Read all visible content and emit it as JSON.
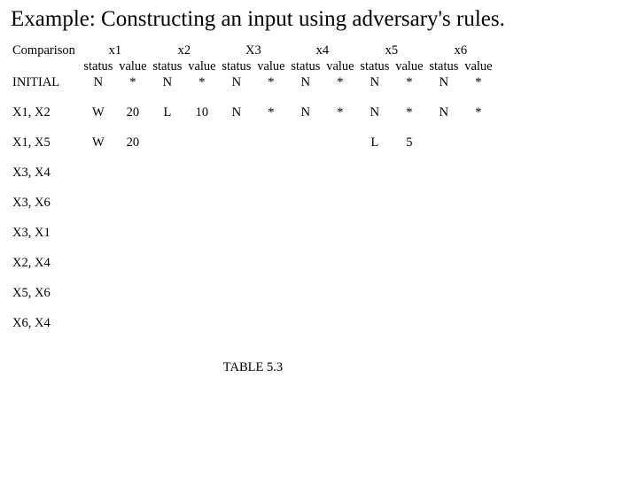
{
  "title": "Example: Constructing an input using adversary's rules.",
  "caption": "TABLE 5.3",
  "headers": {
    "comparison": "Comparison",
    "vars": [
      "x1",
      "x2",
      "X3",
      "x4",
      "x5",
      "x6"
    ],
    "sub": {
      "status": "status",
      "value": "value"
    }
  },
  "rows": [
    {
      "label": "INITIAL",
      "cells": [
        [
          "N",
          "*"
        ],
        [
          "N",
          "*"
        ],
        [
          "N",
          "*"
        ],
        [
          "N",
          "*"
        ],
        [
          "N",
          "*"
        ],
        [
          "N",
          "*"
        ]
      ]
    },
    {
      "label": "X1, X2",
      "cells": [
        [
          "W",
          "20"
        ],
        [
          "L",
          "10"
        ],
        [
          "N",
          "*"
        ],
        [
          "N",
          "*"
        ],
        [
          "N",
          "*"
        ],
        [
          "N",
          "*"
        ]
      ]
    },
    {
      "label": "X1, X5",
      "cells": [
        [
          "W",
          "20"
        ],
        [
          "",
          ""
        ],
        [
          "",
          ""
        ],
        [
          "",
          ""
        ],
        [
          "L",
          "5"
        ],
        [
          "",
          ""
        ]
      ]
    },
    {
      "label": "X3, X4",
      "cells": [
        [
          "",
          ""
        ],
        [
          "",
          ""
        ],
        [
          "",
          ""
        ],
        [
          "",
          ""
        ],
        [
          "",
          ""
        ],
        [
          "",
          ""
        ]
      ]
    },
    {
      "label": "X3, X6",
      "cells": [
        [
          "",
          ""
        ],
        [
          "",
          ""
        ],
        [
          "",
          ""
        ],
        [
          "",
          ""
        ],
        [
          "",
          ""
        ],
        [
          "",
          ""
        ]
      ]
    },
    {
      "label": "X3, X1",
      "cells": [
        [
          "",
          ""
        ],
        [
          "",
          ""
        ],
        [
          "",
          ""
        ],
        [
          "",
          ""
        ],
        [
          "",
          ""
        ],
        [
          "",
          ""
        ]
      ]
    },
    {
      "label": "X2, X4",
      "cells": [
        [
          "",
          ""
        ],
        [
          "",
          ""
        ],
        [
          "",
          ""
        ],
        [
          "",
          ""
        ],
        [
          "",
          ""
        ],
        [
          "",
          ""
        ]
      ]
    },
    {
      "label": "X5, X6",
      "cells": [
        [
          "",
          ""
        ],
        [
          "",
          ""
        ],
        [
          "",
          ""
        ],
        [
          "",
          ""
        ],
        [
          "",
          ""
        ],
        [
          "",
          ""
        ]
      ]
    },
    {
      "label": "X6, X4",
      "cells": [
        [
          "",
          ""
        ],
        [
          "",
          ""
        ],
        [
          "",
          ""
        ],
        [
          "",
          ""
        ],
        [
          "",
          ""
        ],
        [
          "",
          ""
        ]
      ]
    }
  ],
  "chart_data": {
    "type": "table",
    "title": "TABLE 5.3",
    "columns": [
      "Comparison",
      "x1 status",
      "x1 value",
      "x2 status",
      "x2 value",
      "X3 status",
      "X3 value",
      "x4 status",
      "x4 value",
      "x5 status",
      "x5 value",
      "x6 status",
      "x6 value"
    ],
    "rows": [
      [
        "INITIAL",
        "N",
        "*",
        "N",
        "*",
        "N",
        "*",
        "N",
        "*",
        "N",
        "*",
        "N",
        "*"
      ],
      [
        "X1, X2",
        "W",
        "20",
        "L",
        "10",
        "N",
        "*",
        "N",
        "*",
        "N",
        "*",
        "N",
        "*"
      ],
      [
        "X1, X5",
        "W",
        "20",
        "",
        "",
        "",
        "",
        "",
        "",
        "L",
        "5",
        "",
        ""
      ],
      [
        "X3, X4",
        "",
        "",
        "",
        "",
        "",
        "",
        "",
        "",
        "",
        "",
        "",
        ""
      ],
      [
        "X3, X6",
        "",
        "",
        "",
        "",
        "",
        "",
        "",
        "",
        "",
        "",
        "",
        ""
      ],
      [
        "X3, X1",
        "",
        "",
        "",
        "",
        "",
        "",
        "",
        "",
        "",
        "",
        "",
        ""
      ],
      [
        "X2, X4",
        "",
        "",
        "",
        "",
        "",
        "",
        "",
        "",
        "",
        "",
        "",
        ""
      ],
      [
        "X5, X6",
        "",
        "",
        "",
        "",
        "",
        "",
        "",
        "",
        "",
        "",
        "",
        ""
      ],
      [
        "X6, X4",
        "",
        "",
        "",
        "",
        "",
        "",
        "",
        "",
        "",
        "",
        "",
        ""
      ]
    ]
  }
}
